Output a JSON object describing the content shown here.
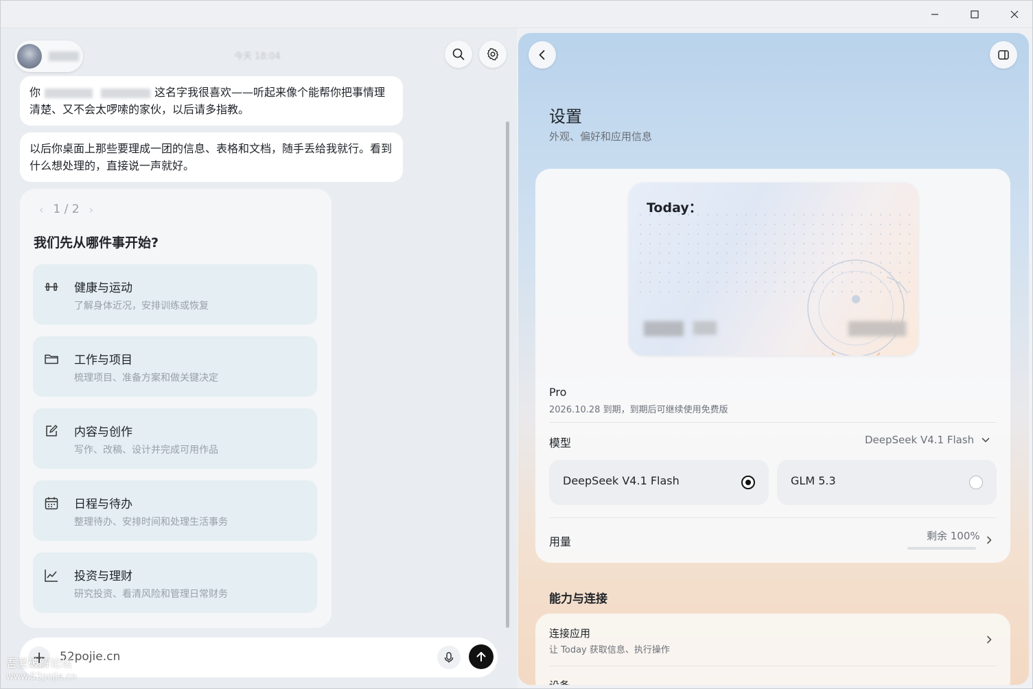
{
  "window": {
    "controls": [
      "minimize",
      "maximize",
      "close"
    ]
  },
  "chat": {
    "timestamp": "今天 18:04",
    "messages": [
      {
        "part1": "你",
        "part2": "这名字我很喜欢——听起来像个能帮你把事情理清楚、又不会太啰嗦的家伙，以后请多指教。"
      },
      {
        "text": "以后你桌面上那些要理成一团的信息、表格和文档，随手丢给我就行。看到什么想处理的，直接说一声就好。"
      }
    ],
    "suggestion_card": {
      "pager": "1 / 2",
      "title": "我们先从哪件事开始?",
      "options": [
        {
          "title": "健康与运动",
          "subtitle": "了解身体近况，安排训练或恢复",
          "icon": "dumbbell-icon"
        },
        {
          "title": "工作与项目",
          "subtitle": "梳理项目、准备方案和做关键决定",
          "icon": "folder-icon"
        },
        {
          "title": "内容与创作",
          "subtitle": "写作、改稿、设计并完成可用作品",
          "icon": "edit-icon"
        },
        {
          "title": "日程与待办",
          "subtitle": "整理待办、安排时间和处理生活事务",
          "icon": "calendar-icon"
        },
        {
          "title": "投资与理财",
          "subtitle": "研究投资、看清风险和管理日常财务",
          "icon": "chart-trend-icon"
        }
      ]
    },
    "input": {
      "value": "52pojie.cn"
    },
    "watermark": {
      "line1": "吾爱破解论坛",
      "line2": "www.52pojie.cn"
    }
  },
  "settings": {
    "title": "设置",
    "subtitle": "外观、偏好和应用信息",
    "card": {
      "label": "Today："
    },
    "plan": {
      "name": "Pro",
      "expiry": "2026.10.28 到期，到期后可继续使用免费版"
    },
    "model": {
      "label": "模型",
      "selected": "DeepSeek V4.1 Flash",
      "options": [
        {
          "name": "DeepSeek V4.1 Flash",
          "selected": true
        },
        {
          "name": "GLM 5.3",
          "selected": false
        }
      ]
    },
    "usage": {
      "label": "用量",
      "value": "剩余 100%",
      "remaining_fraction": 1.0
    },
    "section": "能力与连接",
    "connect": {
      "title": "连接应用",
      "subtitle": "让 Today 获取信息、执行操作"
    },
    "next_item": "设备"
  },
  "colors": {
    "send_button": "#111111",
    "option_bg": "#e4eef3"
  }
}
